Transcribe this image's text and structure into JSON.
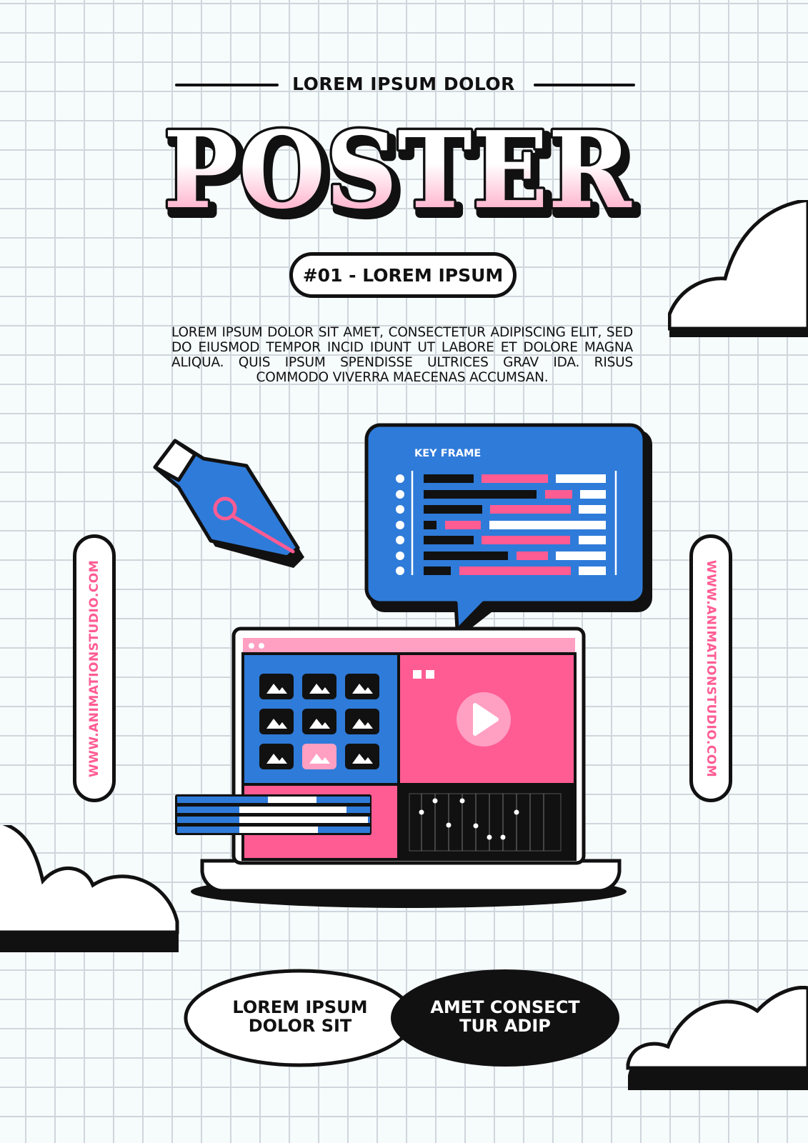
{
  "header": {
    "kicker": "LOREM IPSUM DOLOR",
    "title": "POSTER",
    "issue": "#01 - LOREM IPSUM"
  },
  "body": {
    "paragraph": "LOREM IPSUM DOLOR SIT AMET, CONSECTETUR ADIPISCING ELIT, SED DO EIUSMOD TEMPOR INCID IDUNT UT LABORE ET DOLORE MAGNA ALIQUA. QUIS IPSUM SPENDISSE ULTRICES GRAV IDA. RISUS COMMODO VIVERRA MAECENAS ACCUMSAN."
  },
  "side": {
    "left_url": "WWW.ANIMATIONSTUDIO.COM",
    "right_url": "WWW.ANIMATIONSTUDIO.COM"
  },
  "illustration": {
    "keyframe_label": "KEY FRAME",
    "icons": [
      "pen-nib-icon",
      "play-icon",
      "image-thumbnail-icon",
      "cloud-icon"
    ]
  },
  "footer": {
    "left_ellipse": [
      "LOREM IPSUM",
      "DOLOR SIT"
    ],
    "right_ellipse": [
      "AMET CONSECT",
      "TUR ADIP"
    ]
  },
  "colors": {
    "pink": "#ff5c93",
    "light_pink": "#ff9fc2",
    "blue": "#2f7bd9",
    "black": "#111111",
    "white": "#ffffff"
  }
}
